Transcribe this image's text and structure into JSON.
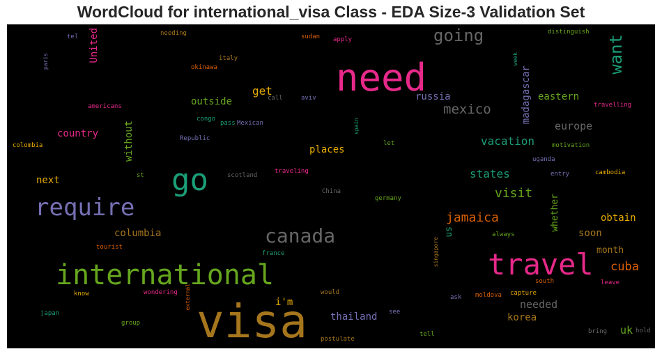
{
  "chart_data": {
    "type": "wordcloud",
    "title": "WordCloud for international_visa Class - EDA Size-3 Validation Set",
    "background": "#000000",
    "words": [
      {
        "text": "visa",
        "size": 66,
        "color": "#a6761d"
      },
      {
        "text": "need",
        "size": 54,
        "color": "#e7298a"
      },
      {
        "text": "go",
        "size": 44,
        "color": "#1b9e77"
      },
      {
        "text": "travel",
        "size": 42,
        "color": "#e7298a"
      },
      {
        "text": "international",
        "size": 40,
        "color": "#66a61e"
      },
      {
        "text": "require",
        "size": 34,
        "color": "#7570b3"
      },
      {
        "text": "canada",
        "size": 28,
        "color": "#666666"
      },
      {
        "text": "going",
        "size": 24,
        "color": "#666666"
      },
      {
        "text": "want",
        "size": 24,
        "color": "#1b9e77",
        "vertical": true
      },
      {
        "text": "mexico",
        "size": 19,
        "color": "#666666"
      },
      {
        "text": "jamaica",
        "size": 18,
        "color": "#d95f02"
      },
      {
        "text": "visit",
        "size": 18,
        "color": "#66a61e"
      },
      {
        "text": "cuba",
        "size": 17,
        "color": "#d95f02"
      },
      {
        "text": "get",
        "size": 16,
        "color": "#e6ab02"
      },
      {
        "text": "states",
        "size": 16,
        "color": "#1b9e77"
      },
      {
        "text": "vacation",
        "size": 16,
        "color": "#1b9e77"
      },
      {
        "text": "europe",
        "size": 15,
        "color": "#666666"
      },
      {
        "text": "needed",
        "size": 15,
        "color": "#666666"
      },
      {
        "text": "thailand",
        "size": 14,
        "color": "#7570b3"
      },
      {
        "text": "russia",
        "size": 14,
        "color": "#7570b3"
      },
      {
        "text": "outside",
        "size": 14,
        "color": "#66a61e"
      },
      {
        "text": "country",
        "size": 14,
        "color": "#e7298a"
      },
      {
        "text": "i'm",
        "size": 14,
        "color": "#e6ab02"
      },
      {
        "text": "uk",
        "size": 15,
        "color": "#66a61e"
      },
      {
        "text": "korea",
        "size": 14,
        "color": "#a6761d"
      },
      {
        "text": "eastern",
        "size": 14,
        "color": "#66a61e"
      },
      {
        "text": "columbia",
        "size": 14,
        "color": "#a6761d"
      },
      {
        "text": "obtain",
        "size": 14,
        "color": "#e6ab02"
      },
      {
        "text": "places",
        "size": 14,
        "color": "#e6ab02"
      },
      {
        "text": "next",
        "size": 14,
        "color": "#e6ab02"
      },
      {
        "text": "soon",
        "size": 14,
        "color": "#a6761d"
      },
      {
        "text": "month",
        "size": 13,
        "color": "#a6761d"
      },
      {
        "text": "madagascar",
        "size": 14,
        "color": "#7570b3",
        "vertical": true
      },
      {
        "text": "without",
        "size": 14,
        "color": "#66a61e",
        "vertical": true
      },
      {
        "text": "United",
        "size": 14,
        "color": "#e7298a",
        "vertical": true
      },
      {
        "text": "whether",
        "size": 13,
        "color": "#66a61e",
        "vertical": true
      },
      {
        "text": "us",
        "size": 13,
        "color": "#1b9e77",
        "vertical": true
      },
      {
        "text": "tel",
        "size": 9,
        "color": "#7570b3"
      },
      {
        "text": "paris",
        "size": 8,
        "color": "#7570b3",
        "vertical": true
      },
      {
        "text": "needing",
        "size": 9,
        "color": "#a6761d"
      },
      {
        "text": "italy",
        "size": 9,
        "color": "#a6761d"
      },
      {
        "text": "okinawa",
        "size": 9,
        "color": "#d95f02"
      },
      {
        "text": "americans",
        "size": 9,
        "color": "#e7298a"
      },
      {
        "text": "colombia",
        "size": 9,
        "color": "#e6ab02"
      },
      {
        "text": "congo",
        "size": 9,
        "color": "#1b9e77"
      },
      {
        "text": "pass",
        "size": 9,
        "color": "#1b9e77"
      },
      {
        "text": "Mexican",
        "size": 9,
        "color": "#7570b3"
      },
      {
        "text": "Republic",
        "size": 9,
        "color": "#7570b3"
      },
      {
        "text": "call",
        "size": 9,
        "color": "#666666"
      },
      {
        "text": "aviv",
        "size": 9,
        "color": "#7570b3"
      },
      {
        "text": "sudan",
        "size": 9,
        "color": "#d95f02"
      },
      {
        "text": "apply",
        "size": 9,
        "color": "#e7298a"
      },
      {
        "text": "week",
        "size": 8,
        "color": "#1b9e77",
        "vertical": true
      },
      {
        "text": "distinguish",
        "size": 9,
        "color": "#66a61e"
      },
      {
        "text": "travelling",
        "size": 9,
        "color": "#e7298a"
      },
      {
        "text": "spain",
        "size": 8,
        "color": "#1b9e77",
        "vertical": true
      },
      {
        "text": "let",
        "size": 9,
        "color": "#66a61e"
      },
      {
        "text": "motivation",
        "size": 9,
        "color": "#66a61e"
      },
      {
        "text": "uganda",
        "size": 9,
        "color": "#7570b3"
      },
      {
        "text": "st",
        "size": 9,
        "color": "#66a61e"
      },
      {
        "text": "scotland",
        "size": 9,
        "color": "#666666"
      },
      {
        "text": "traveling",
        "size": 9,
        "color": "#e7298a"
      },
      {
        "text": "entry",
        "size": 9,
        "color": "#7570b3"
      },
      {
        "text": "cambodia",
        "size": 9,
        "color": "#e6ab02"
      },
      {
        "text": "China",
        "size": 9,
        "color": "#666666"
      },
      {
        "text": "germany",
        "size": 9,
        "color": "#66a61e"
      },
      {
        "text": "always",
        "size": 9,
        "color": "#66a61e"
      },
      {
        "text": "tourist",
        "size": 9,
        "color": "#d95f02"
      },
      {
        "text": "france",
        "size": 9,
        "color": "#1b9e77"
      },
      {
        "text": "singapore",
        "size": 8,
        "color": "#a6761d",
        "vertical": true
      },
      {
        "text": "south",
        "size": 9,
        "color": "#d95f02"
      },
      {
        "text": "leave",
        "size": 9,
        "color": "#e7298a"
      },
      {
        "text": "know",
        "size": 9,
        "color": "#e6ab02"
      },
      {
        "text": "wondering",
        "size": 9,
        "color": "#e7298a"
      },
      {
        "text": "external",
        "size": 8,
        "color": "#d95f02",
        "vertical": true
      },
      {
        "text": "would",
        "size": 9,
        "color": "#a6761d"
      },
      {
        "text": "ask",
        "size": 9,
        "color": "#7570b3"
      },
      {
        "text": "moldova",
        "size": 9,
        "color": "#d95f02"
      },
      {
        "text": "capture",
        "size": 9,
        "color": "#e6ab02"
      },
      {
        "text": "japan",
        "size": 9,
        "color": "#1b9e77"
      },
      {
        "text": "group",
        "size": 9,
        "color": "#66a61e"
      },
      {
        "text": "see",
        "size": 9,
        "color": "#7570b3"
      },
      {
        "text": "postulate",
        "size": 9,
        "color": "#a6761d"
      },
      {
        "text": "tell",
        "size": 9,
        "color": "#66a61e"
      },
      {
        "text": "bring",
        "size": 9,
        "color": "#666666"
      },
      {
        "text": "hold",
        "size": 9,
        "color": "#666666"
      }
    ]
  }
}
